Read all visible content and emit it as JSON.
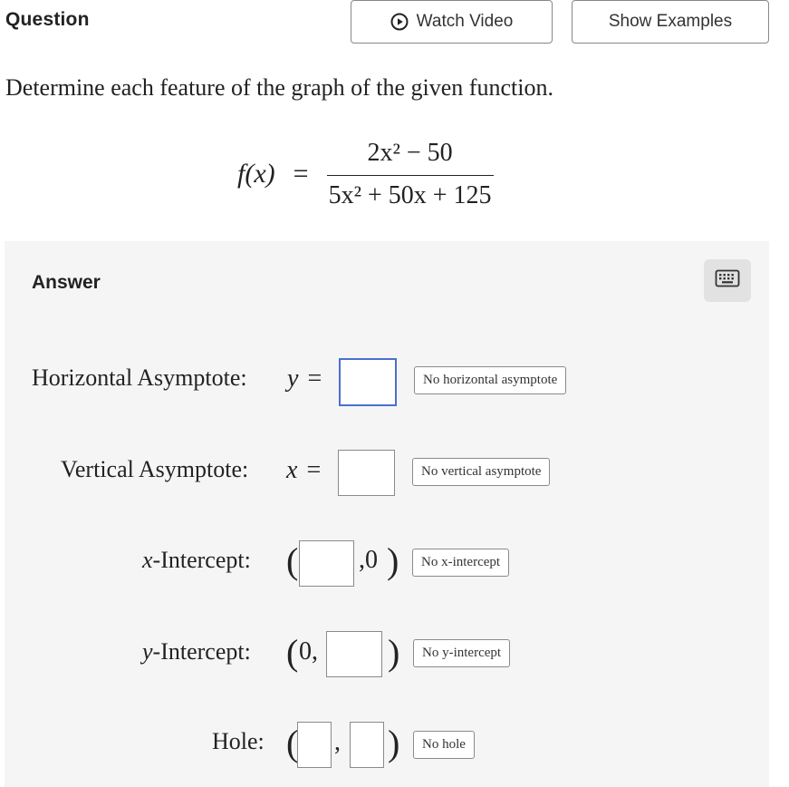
{
  "header": {
    "title": "Question",
    "watch_video": "Watch Video",
    "watch_icon": "play-circle-icon",
    "show_examples": "Show Examples"
  },
  "prompt": "Determine each feature of the graph of the given function.",
  "function": {
    "lhs": "f(x)",
    "numerator": "2x² − 50",
    "denominator": "5x² + 50x + 125"
  },
  "answer": {
    "label": "Answer",
    "keyboard_icon": "keyboard-icon",
    "horizontal_asymptote": {
      "label": "Horizontal Asymptote:",
      "var": "y",
      "none_button": "No horizontal asymptote"
    },
    "vertical_asymptote": {
      "label": "Vertical Asymptote:",
      "var": "x",
      "none_button": "No vertical asymptote"
    },
    "x_intercept": {
      "label": "-Intercept:",
      "var": "x",
      "fixed_value": "0",
      "none_button": "No x-intercept"
    },
    "y_intercept": {
      "label": "-Intercept:",
      "var": "y",
      "fixed_value": "0",
      "none_button": "No y-intercept"
    },
    "hole": {
      "label": "Hole:",
      "none_button": "No hole"
    }
  },
  "colors": {
    "focus_border": "#4a6fd0",
    "panel_bg": "#f5f5f5",
    "keyboard_bg": "#e2e2e2"
  }
}
